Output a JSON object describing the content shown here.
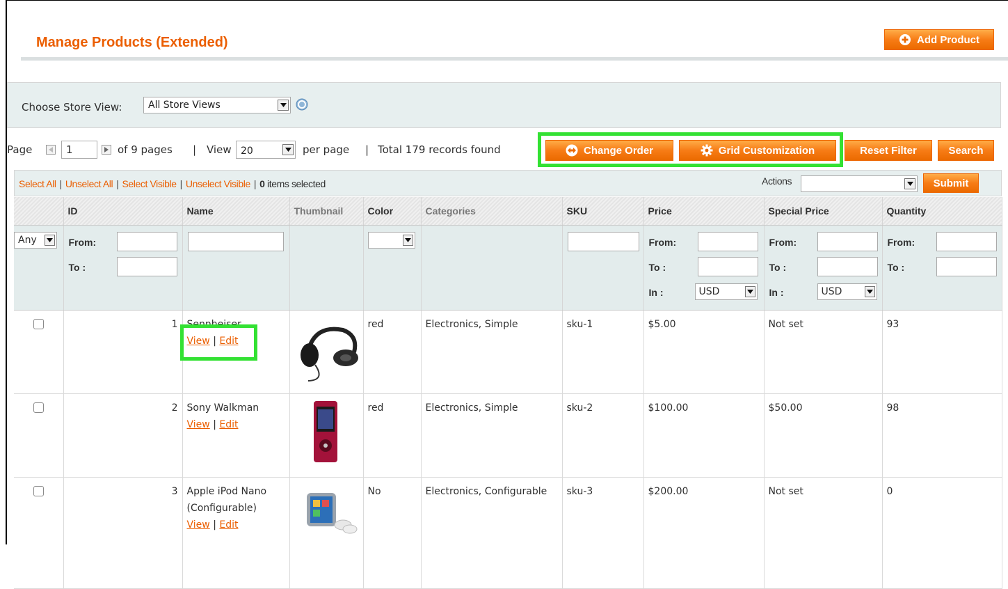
{
  "header": {
    "title": "Manage Products (Extended)",
    "add_product": "Add Product"
  },
  "store": {
    "label": "Choose Store View:",
    "selected": "All Store Views"
  },
  "pager": {
    "page_label": "Page",
    "page_value": "1",
    "of_pages": "of 9 pages",
    "sep1": "|",
    "view_label": "View",
    "view_value": "20",
    "per_page": "per page",
    "sep2": "|",
    "total": "Total 179 records found"
  },
  "buttons": {
    "change_order": "Change Order",
    "grid_customization": "Grid Customization",
    "reset_filter": "Reset Filter",
    "search": "Search",
    "submit": "Submit"
  },
  "mass": {
    "select_all": "Select All",
    "unselect_all": "Unselect All",
    "select_visible": "Select Visible",
    "unselect_visible": "Unselect Visible",
    "sep": "|",
    "count": "0",
    "items_selected": "items selected",
    "actions_label": "Actions"
  },
  "columns": [
    "ID",
    "Name",
    "Thumbnail",
    "Color",
    "Categories",
    "SKU",
    "Price",
    "Special Price",
    "Quantity"
  ],
  "filters": {
    "any": "Any",
    "from": "From:",
    "to": "To :",
    "in": "In :",
    "currency": "USD"
  },
  "rows": [
    {
      "id": "1",
      "name": "Sennheiser",
      "view": "View",
      "sep": "|",
      "edit": "Edit",
      "color": "red",
      "categories": "Electronics, Simple",
      "sku": "sku-1",
      "price": "$5.00",
      "special": "Not set",
      "qty": "93"
    },
    {
      "id": "2",
      "name": "Sony Walkman",
      "view": "View",
      "sep": "|",
      "edit": "Edit",
      "color": "red",
      "categories": "Electronics, Simple",
      "sku": "sku-2",
      "price": "$100.00",
      "special": "$50.00",
      "qty": "98"
    },
    {
      "id": "3",
      "name": "Apple iPod Nano (Configurable)",
      "view": "View",
      "sep": "|",
      "edit": "Edit",
      "color": "No",
      "categories": "Electronics, Configurable",
      "sku": "sku-3",
      "price": "$200.00",
      "special": "Not set",
      "qty": "0"
    }
  ],
  "icons": {
    "add": "plus-circle-icon",
    "change_order": "swap-arrows-icon",
    "grid": "gear-icon",
    "help": "help-icon",
    "dropdown": "triangle-down-icon"
  },
  "colors": {
    "accent": "#eb5e00",
    "highlight": "#33e133",
    "panel": "#e7efef"
  }
}
